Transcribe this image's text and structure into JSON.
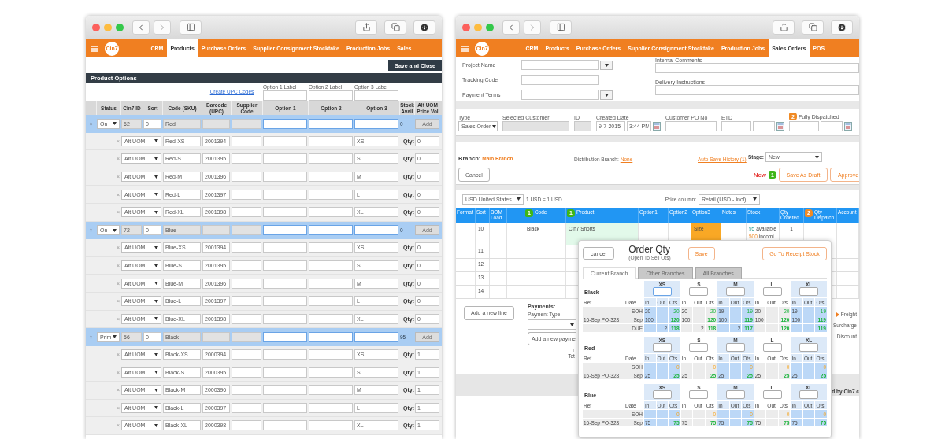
{
  "product_window": {
    "nav": {
      "logo": "Cin7",
      "tabs": [
        {
          "label": "CRM",
          "selected": false
        },
        {
          "label": "Products",
          "selected": true
        },
        {
          "label": "Purchase Orders",
          "selected": false
        },
        {
          "label": "Supplier Consignment Stocktake",
          "selected": false
        },
        {
          "label": "Production Jobs",
          "selected": false
        },
        {
          "label": "Sales",
          "selected": false
        }
      ]
    },
    "save_button": "Save and Close",
    "section_title": "Product Options",
    "create_upc_link": "Create UPC Codes",
    "option_labels": [
      "Option 1 Label",
      "Option 2 Label",
      "Option 3 Label"
    ],
    "columns": [
      "Status",
      "Cin7 ID",
      "Sort",
      "Code (SKU)",
      "Barcode (UPC)",
      "Supplier Code",
      "Option 1",
      "Option 2",
      "Option 3",
      "Stock Avail",
      "Alt UOM Price Vol"
    ],
    "rows": [
      {
        "kind": "variant",
        "remove": "×",
        "status": "On",
        "id": "62",
        "sort": "0",
        "code": "Red",
        "stock": "0",
        "action": "Add"
      },
      {
        "kind": "uom",
        "remove": "×",
        "uom": "Alt UOM",
        "code": "Red-XS",
        "barcode": "2001394",
        "option3": "XS",
        "qty_label": "Qty:",
        "qty": "0"
      },
      {
        "kind": "uom",
        "remove": "×",
        "uom": "Alt UOM",
        "code": "Red-S",
        "barcode": "2001395",
        "option3": "S",
        "qty_label": "Qty:",
        "qty": "0"
      },
      {
        "kind": "uom",
        "remove": "×",
        "uom": "Alt UOM",
        "code": "Red-M",
        "barcode": "2001396",
        "option3": "M",
        "qty_label": "Qty:",
        "qty": "0"
      },
      {
        "kind": "uom",
        "remove": "×",
        "uom": "Alt UOM",
        "code": "Red-L",
        "barcode": "2001397",
        "option3": "L",
        "qty_label": "Qty:",
        "qty": "0"
      },
      {
        "kind": "uom",
        "remove": "×",
        "uom": "Alt UOM",
        "code": "Red-XL",
        "barcode": "2001398",
        "option3": "XL",
        "qty_label": "Qty:",
        "qty": "0"
      },
      {
        "kind": "variant",
        "remove": "×",
        "status": "On",
        "id": "72",
        "sort": "0",
        "code": "Blue",
        "stock": "0",
        "action": "Add"
      },
      {
        "kind": "uom",
        "remove": "×",
        "uom": "Alt UOM",
        "code": "Blue-XS",
        "barcode": "2001394",
        "option3": "XS",
        "qty_label": "Qty:",
        "qty": "0"
      },
      {
        "kind": "uom",
        "remove": "×",
        "uom": "Alt UOM",
        "code": "Blue-S",
        "barcode": "2001395",
        "option3": "S",
        "qty_label": "Qty:",
        "qty": "0"
      },
      {
        "kind": "uom",
        "remove": "×",
        "uom": "Alt UOM",
        "code": "Blue-M",
        "barcode": "2001396",
        "option3": "M",
        "qty_label": "Qty:",
        "qty": "0"
      },
      {
        "kind": "uom",
        "remove": "×",
        "uom": "Alt UOM",
        "code": "Blue-L",
        "barcode": "2001397",
        "option3": "L",
        "qty_label": "Qty:",
        "qty": "0"
      },
      {
        "kind": "uom",
        "remove": "×",
        "uom": "Alt UOM",
        "code": "Blue-XL",
        "barcode": "2001398",
        "option3": "XL",
        "qty_label": "Qty:",
        "qty": "0"
      },
      {
        "kind": "variant",
        "remove": "×",
        "status": "Prim",
        "id": "56",
        "sort": "0",
        "code": "Black",
        "stock": "95",
        "action": "Add"
      },
      {
        "kind": "uom",
        "remove": "×",
        "uom": "Alt UOM",
        "code": "Black-XS",
        "barcode": "2000394",
        "option3": "XS",
        "qty_label": "Qty:",
        "qty": "1"
      },
      {
        "kind": "uom",
        "remove": "×",
        "uom": "Alt UOM",
        "code": "Black-S",
        "barcode": "2000395",
        "option3": "S",
        "qty_label": "Qty:",
        "qty": "1"
      },
      {
        "kind": "uom",
        "remove": "×",
        "uom": "Alt UOM",
        "code": "Black-M",
        "barcode": "2000396",
        "option3": "M",
        "qty_label": "Qty:",
        "qty": "1"
      },
      {
        "kind": "uom",
        "remove": "×",
        "uom": "Alt UOM",
        "code": "Black-L",
        "barcode": "2000397",
        "option3": "L",
        "qty_label": "Qty:",
        "qty": "1"
      },
      {
        "kind": "uom",
        "remove": "×",
        "uom": "Alt UOM",
        "code": "Black-XL",
        "barcode": "2000398",
        "option3": "XL",
        "qty_label": "Qty:",
        "qty": "1"
      }
    ]
  },
  "order_window": {
    "nav": {
      "logo": "Cin7",
      "tabs": [
        {
          "label": "CRM",
          "selected": false
        },
        {
          "label": "Products",
          "selected": false
        },
        {
          "label": "Purchase Orders",
          "selected": false
        },
        {
          "label": "Supplier Consignment Stocktake",
          "selected": false
        },
        {
          "label": "Production Jobs",
          "selected": false
        },
        {
          "label": "Sales Orders",
          "selected": true
        },
        {
          "label": "POS",
          "selected": false
        }
      ]
    },
    "left_fields": [
      {
        "kind": "dropdown",
        "label": "Project Name"
      },
      {
        "kind": "text",
        "label": "Tracking Code"
      },
      {
        "kind": "dropdown",
        "label": "Payment Terms"
      }
    ],
    "right_fields": [
      {
        "label": "Internal Comments"
      },
      {
        "label": "Delivery Instructions"
      }
    ],
    "header_fields": [
      {
        "kind": "select",
        "label": "Type",
        "value": "Sales Order"
      },
      {
        "kind": "readonly",
        "label": "Selected Customer"
      },
      {
        "kind": "readonly",
        "label": "ID"
      },
      {
        "kind": "datetime",
        "label": "Created Date",
        "values": [
          "9-7-2015",
          "3:44 PM"
        ]
      },
      {
        "kind": "text",
        "label": "Customer PO No"
      },
      {
        "kind": "daterange",
        "label": "ETD"
      },
      {
        "kind": "daterange",
        "label": "Fully Dispatched",
        "badge": "2",
        "color": "#f08a24"
      }
    ],
    "branch": {
      "label": "Branch:",
      "value": "Main Branch",
      "distribution_label": "Distribution Branch:",
      "distribution": "None",
      "autosave": "Auto Save History (1)",
      "stage_label": "Stage:",
      "stage": "New"
    },
    "actions": {
      "cancel": "Cancel",
      "status": "New",
      "badge": "1",
      "color": "#3fb618",
      "save_draft": "Save As Draft",
      "approve": "Approve"
    },
    "currency": {
      "value": "USD United States",
      "rate": "1 USD = 1 USD",
      "price_label": "Price column:",
      "price": "Retail (USD - Incl)"
    },
    "lines": {
      "columns": [
        {
          "label": "Format"
        },
        {
          "label": "Sort"
        },
        {
          "label": "BOM Load"
        },
        {
          "label": "Code",
          "badge": "1",
          "color": "#3fb618"
        },
        {
          "label": "Product",
          "badge": "1",
          "color": "#3fb618"
        },
        {
          "label": "Option1"
        },
        {
          "label": "Option2"
        },
        {
          "label": "Option3"
        },
        {
          "label": "Notes"
        },
        {
          "label": "Stock"
        },
        {
          "label": "Qty Ordered"
        },
        {
          "label": "Qty Dispatch",
          "badge": "2",
          "color": "#f08a24"
        },
        {
          "label": "Account"
        }
      ],
      "rows": [
        {
          "sort": "10",
          "code": "Black",
          "product": "Cin7 Shorts",
          "option3": "Size",
          "stock": [
            {
              "kind": "available",
              "amount": "95",
              "note": "available"
            },
            {
              "kind": "incoming",
              "amount": "500",
              "note": "incomi"
            }
          ],
          "qty_ordered": "1"
        },
        {
          "sort": "11"
        },
        {
          "sort": "12"
        },
        {
          "sort": "13"
        },
        {
          "sort": "14"
        }
      ]
    },
    "add_line": "Add a new line",
    "payments": {
      "title": "Payments:",
      "type_label": "Payment Type",
      "add_button": "Add a new payme",
      "totals": [
        "T",
        "Tot"
      ]
    },
    "charges": [
      {
        "label": "Freight",
        "marked": true
      },
      {
        "label": "Surcharge",
        "marked": false
      },
      {
        "label": "Discount",
        "marked": false
      }
    ],
    "footer": "d by Cin7.c",
    "order_qty": {
      "cancel": "cancel",
      "title": "Order Qty",
      "subtitle": "(Open To Sell Ots)",
      "save": "Save",
      "receipt": "Go To Receipt Stock",
      "tabs": [
        {
          "label": "Current Branch",
          "selected": true
        },
        {
          "label": "Other Branches",
          "selected": false
        },
        {
          "label": "All Branches",
          "selected": false
        }
      ],
      "groups": [
        {
          "name": "Black",
          "ref_label": "Ref",
          "date_label": "Date",
          "sizes": [
            {
              "label": "XS",
              "focused": true,
              "columns": [
                "In",
                "Out",
                "Ots"
              ]
            },
            {
              "label": "S",
              "focused": false,
              "columns": [
                "In",
                "Out",
                "Ots"
              ]
            },
            {
              "label": "M",
              "focused": false,
              "columns": [
                "In",
                "Out",
                "Ots"
              ]
            },
            {
              "label": "L",
              "focused": false,
              "columns": [
                "In",
                "Out",
                "Ots"
              ]
            },
            {
              "label": "XL",
              "focused": false,
              "columns": [
                "In",
                "Out",
                "Ots"
              ]
            }
          ],
          "rows": [
            {
              "kind": "soh",
              "ots_empty": false,
              "date": "SOH",
              "cells": [
                {
                  "in": "20",
                  "ots": "20"
                },
                {
                  "in": "20",
                  "ots": "20"
                },
                {
                  "in": "19",
                  "ots": "19"
                },
                {
                  "in": "20",
                  "ots": "20"
                },
                {
                  "in": "19",
                  "ots": "19"
                }
              ]
            },
            {
              "kind": "po",
              "ots_empty": false,
              "ref": "16-Sep PO-328",
              "date": "Sep",
              "cells": [
                {
                  "in": "100",
                  "ots": "120"
                },
                {
                  "in": "100",
                  "ots": "120"
                },
                {
                  "in": "100",
                  "ots": "119"
                },
                {
                  "in": "100",
                  "ots": "120"
                },
                {
                  "in": "100",
                  "ots": "119"
                }
              ]
            },
            {
              "kind": "due",
              "ots_empty": false,
              "date": "DUE",
              "cells": [
                {
                  "out": "2",
                  "ots": "118"
                },
                {
                  "out": "2",
                  "ots": "118"
                },
                {
                  "out": "2",
                  "ots": "117"
                },
                {
                  "ots": "120"
                },
                {
                  "ots": "119"
                }
              ]
            }
          ]
        },
        {
          "name": "Red",
          "ref_label": "Ref",
          "date_label": "Date",
          "sizes": [
            {
              "label": "XS",
              "focused": false,
              "columns": [
                "In",
                "Out",
                "Ots"
              ]
            },
            {
              "label": "S",
              "focused": false,
              "columns": [
                "In",
                "Out",
                "Ots"
              ]
            },
            {
              "label": "M",
              "focused": false,
              "columns": [
                "In",
                "Out",
                "Ots"
              ]
            },
            {
              "label": "L",
              "focused": false,
              "columns": [
                "In",
                "Out",
                "Ots"
              ]
            },
            {
              "label": "XL",
              "focused": false,
              "columns": [
                "In",
                "Out",
                "Ots"
              ]
            }
          ],
          "rows": [
            {
              "kind": "soh",
              "ots_empty": true,
              "date": "SOH",
              "cells": [
                {
                  "ots": "0"
                },
                {
                  "ots": "0"
                },
                {
                  "ots": "0"
                },
                {
                  "ots": "0"
                },
                {
                  "ots": "0"
                }
              ]
            },
            {
              "kind": "po",
              "ots_empty": false,
              "ref": "16-Sep PO-328",
              "date": "Sep",
              "cells": [
                {
                  "in": "25",
                  "ots": "25"
                },
                {
                  "in": "25",
                  "ots": "25"
                },
                {
                  "in": "25",
                  "ots": "25"
                },
                {
                  "in": "25",
                  "ots": "25"
                },
                {
                  "in": "25",
                  "ots": "25"
                }
              ]
            }
          ]
        },
        {
          "name": "Blue",
          "ref_label": "Ref",
          "date_label": "Date",
          "sizes": [
            {
              "label": "XS",
              "focused": false,
              "columns": [
                "In",
                "Out",
                "Ots"
              ]
            },
            {
              "label": "S",
              "focused": false,
              "columns": [
                "In",
                "Out",
                "Ots"
              ]
            },
            {
              "label": "M",
              "focused": false,
              "columns": [
                "In",
                "Out",
                "Ots"
              ]
            },
            {
              "label": "L",
              "focused": false,
              "columns": [
                "In",
                "Out",
                "Ots"
              ]
            },
            {
              "label": "XL",
              "focused": false,
              "columns": [
                "In",
                "Out",
                "Ots"
              ]
            }
          ],
          "rows": [
            {
              "kind": "soh",
              "ots_empty": true,
              "date": "SOH",
              "cells": [
                {
                  "ots": "0"
                },
                {
                  "ots": "0"
                },
                {
                  "ots": "0"
                },
                {
                  "ots": "0"
                },
                {
                  "ots": "0"
                }
              ]
            },
            {
              "kind": "po",
              "ots_empty": false,
              "ref": "16-Sep PO-328",
              "date": "Sep",
              "cells": [
                {
                  "in": "75",
                  "ots": "75"
                },
                {
                  "in": "75",
                  "ots": "75"
                },
                {
                  "in": "75",
                  "ots": "75"
                },
                {
                  "in": "75",
                  "ots": "75"
                },
                {
                  "in": "75",
                  "ots": "75"
                }
              ]
            }
          ]
        }
      ]
    }
  }
}
